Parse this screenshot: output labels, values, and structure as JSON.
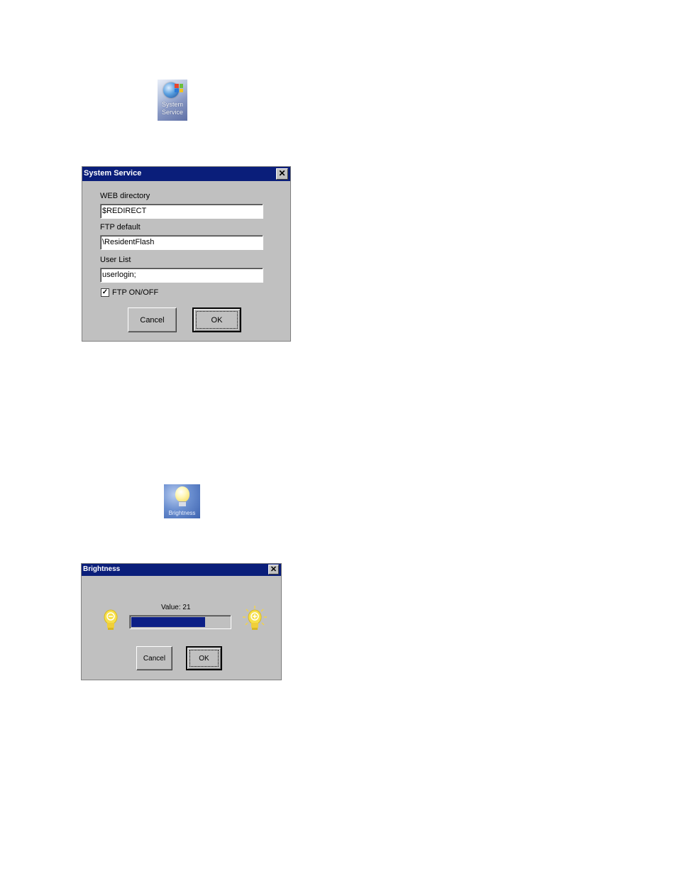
{
  "system_service_icon": {
    "label_line1": "System",
    "label_line2": "Service",
    "icon": "system-service-icon"
  },
  "system_service_dialog": {
    "title": "System Service",
    "close_glyph": "✕",
    "web_directory": {
      "label": "WEB directory",
      "value": "$REDIRECT"
    },
    "ftp_default": {
      "label": "FTP default",
      "value": "\\ResidentFlash"
    },
    "user_list": {
      "label": "User List",
      "value": "userlogin;"
    },
    "ftp_toggle": {
      "label": "FTP ON/OFF",
      "checked": true,
      "check_glyph": "✓"
    },
    "cancel_label": "Cancel",
    "ok_label": "OK"
  },
  "brightness_icon": {
    "label": "Brightness",
    "icon": "brightness-icon"
  },
  "brightness_dialog": {
    "title": "Brightness",
    "close_glyph": "✕",
    "value_text": "Value: 21",
    "level_fraction": 0.75,
    "cancel_label": "Cancel",
    "ok_label": "OK"
  },
  "colors": {
    "titlebar": "#0a1e7a",
    "dialog_bg": "#c0c0c0",
    "slider_fill": "#0c1f86",
    "bulb": "#f6e04a"
  }
}
